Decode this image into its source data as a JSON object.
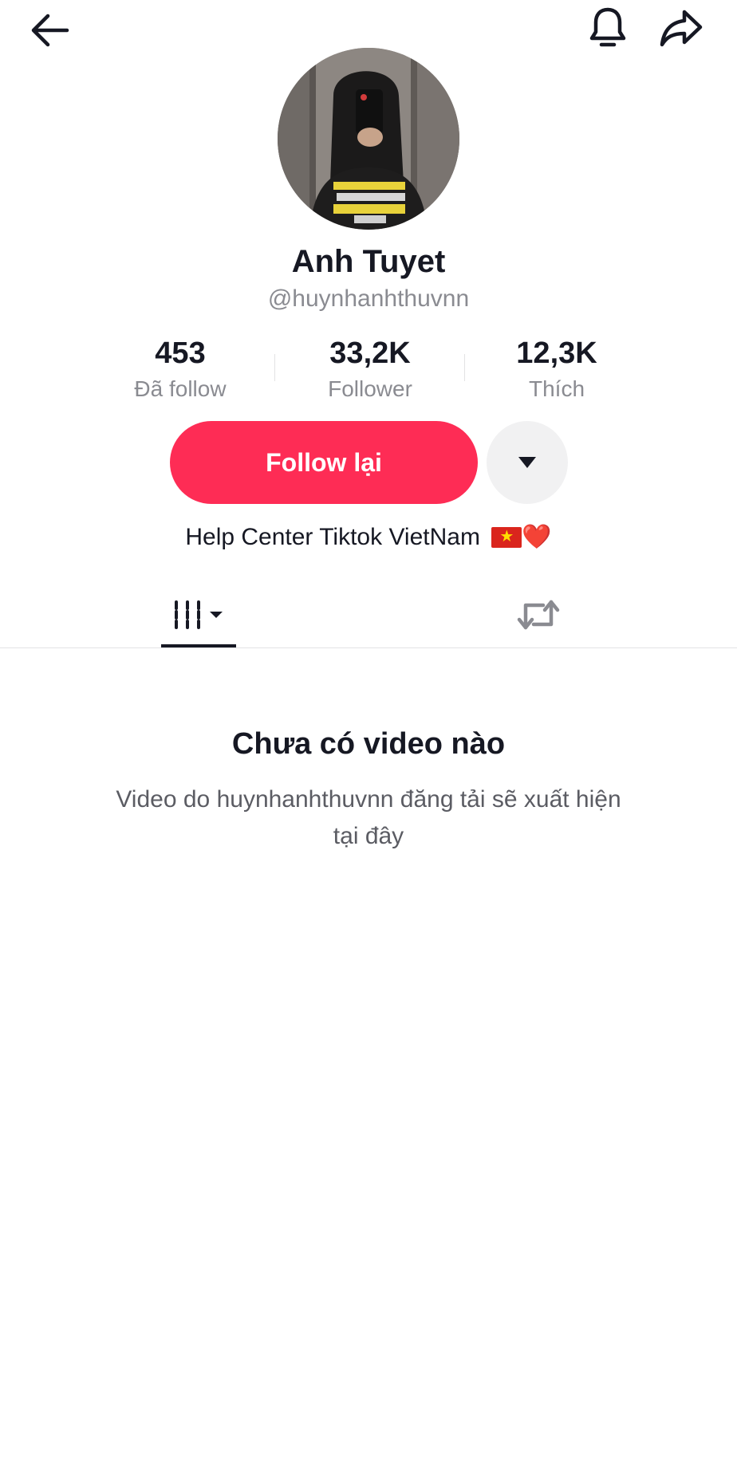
{
  "header": {
    "back_icon": "arrow-left-icon",
    "bell_icon": "bell-icon",
    "share_icon": "share-arrow-icon"
  },
  "profile": {
    "display_name": "Anh Tuyet",
    "username": "@huynhanhthuvnn",
    "avatar": "mirror-selfie-photo"
  },
  "stats": {
    "following": {
      "value": "453",
      "label": "Đã follow"
    },
    "followers": {
      "value": "33,2K",
      "label": "Follower"
    },
    "likes": {
      "value": "12,3K",
      "label": "Thích"
    }
  },
  "actions": {
    "follow_back_label": "Follow lại",
    "more_icon": "caret-down-icon"
  },
  "bio": {
    "text": "Help Center Tiktok VietNam",
    "emoji_flag": "vietnam-flag",
    "emoji_heart": "❤️"
  },
  "tabs": [
    {
      "icon": "videos-grid-icon",
      "selected": true
    },
    {
      "icon": "repost-icon",
      "selected": false
    }
  ],
  "empty_state": {
    "title": "Chưa có video nào",
    "description": "Video do huynhanhthuvnn đăng tải sẽ xuất hiện tại đây"
  },
  "colors": {
    "accent": "#fe2c55",
    "text_primary": "#161823",
    "text_secondary": "#8a8b91",
    "button_gray": "#f1f1f2"
  }
}
